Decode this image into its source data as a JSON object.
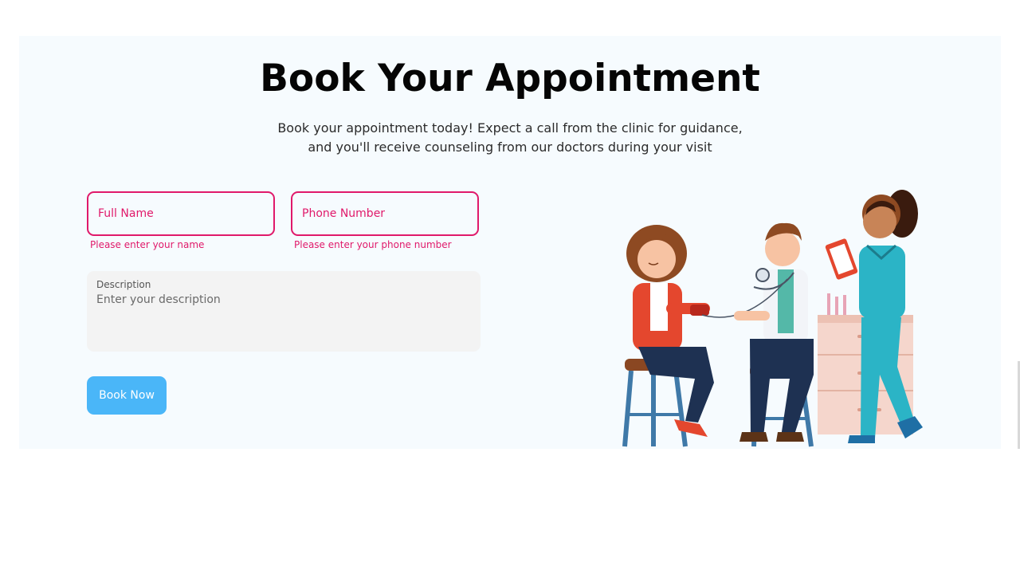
{
  "booking": {
    "title": "Book Your Appointment",
    "subtitle_line1": "Book your appointment today! Expect a call from the clinic for guidance,",
    "subtitle_line2": "and you'll receive counseling from our doctors during your visit",
    "full_name": {
      "placeholder": "Full Name",
      "value": "",
      "error": "Please enter your name"
    },
    "phone": {
      "placeholder": "Phone Number",
      "value": "",
      "error": "Please enter your phone number"
    },
    "description": {
      "label": "Description",
      "placeholder": "Enter your description",
      "value": ""
    },
    "submit_label": "Book Now"
  },
  "illustration": {
    "icon": "doctor-patient-nurse-illustration"
  },
  "colors": {
    "panel_bg": "#f6fbfe",
    "error": "#e0196a",
    "button": "#4ab6f8",
    "title": "#050505"
  }
}
